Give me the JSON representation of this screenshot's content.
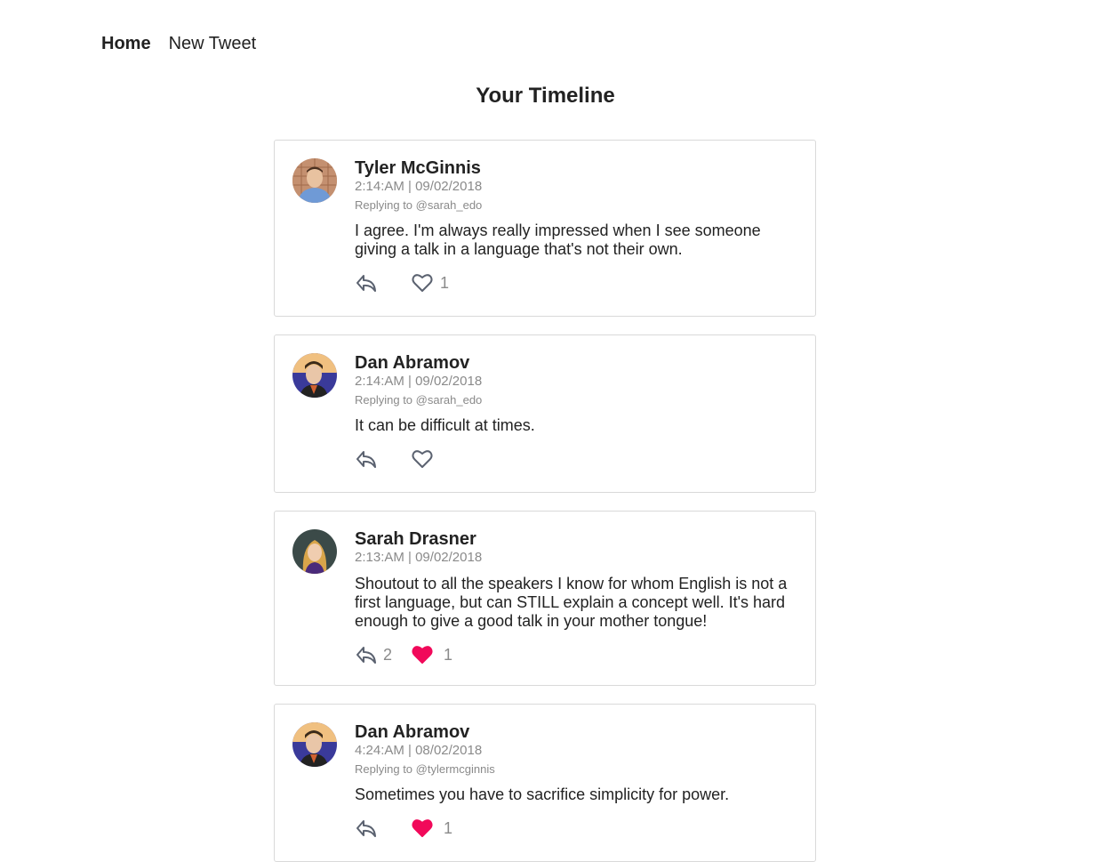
{
  "nav": {
    "home_label": "Home",
    "new_tweet_label": "New Tweet"
  },
  "page_title": "Your Timeline",
  "colors": {
    "liked": "#f1095a",
    "icon_stroke": "#5b6270",
    "muted_text": "#8a8a8a"
  },
  "tweets": [
    {
      "author": "Tyler McGinnis",
      "timestamp": "2:14:AM | 09/02/2018",
      "replying_to": "Replying to @sarah_edo",
      "text": "I agree. I'm always really impressed when I see someone giving a talk in a language that's not their own.",
      "reply_count": "",
      "liked": false,
      "like_count": "1"
    },
    {
      "author": "Dan Abramov",
      "timestamp": "2:14:AM | 09/02/2018",
      "replying_to": "Replying to @sarah_edo",
      "text": "It can be difficult at times.",
      "reply_count": "",
      "liked": false,
      "like_count": ""
    },
    {
      "author": "Sarah Drasner",
      "timestamp": "2:13:AM | 09/02/2018",
      "replying_to": "",
      "text": "Shoutout to all the speakers I know for whom English is not a first language, but can STILL explain a concept well. It's hard enough to give a good talk in your mother tongue!",
      "reply_count": "2",
      "liked": true,
      "like_count": "1"
    },
    {
      "author": "Dan Abramov",
      "timestamp": "4:24:AM | 08/02/2018",
      "replying_to": "Replying to @tylermcginnis",
      "text": "Sometimes you have to sacrifice simplicity for power.",
      "reply_count": "",
      "liked": true,
      "like_count": "1"
    }
  ]
}
